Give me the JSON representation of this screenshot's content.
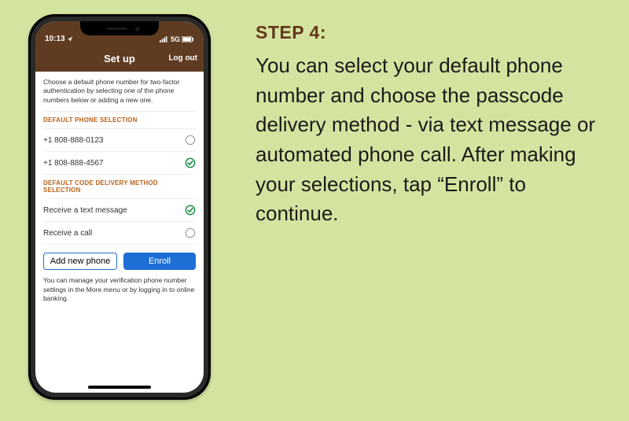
{
  "instruction": {
    "heading": "STEP 4:",
    "body": "You can select your default phone number and choose the passcode delivery method - via text message or automated phone call.  After making your selections, tap “Enroll” to continue."
  },
  "statusbar": {
    "time": "10:13",
    "network": "5G"
  },
  "header": {
    "title": "Set up",
    "logout": "Log out"
  },
  "intro": "Choose a default phone number for two-factor authentication by selecting one of the phone numbers below or adding a new one.",
  "sections": {
    "phone_header": "DEFAULT PHONE SELECTION",
    "phones": [
      {
        "label": "+1 808-888-0123",
        "selected": false
      },
      {
        "label": "+1 808-888-4567",
        "selected": true
      }
    ],
    "method_header": "DEFAULT CODE DELIVERY METHOD SELECTION",
    "methods": [
      {
        "label": "Receive a text message",
        "selected": true
      },
      {
        "label": "Receive a call",
        "selected": false
      }
    ]
  },
  "buttons": {
    "add": "Add new phone",
    "enroll": "Enroll"
  },
  "footer": "You can manage your verification phone number settings in the More menu or by logging in to online banking."
}
